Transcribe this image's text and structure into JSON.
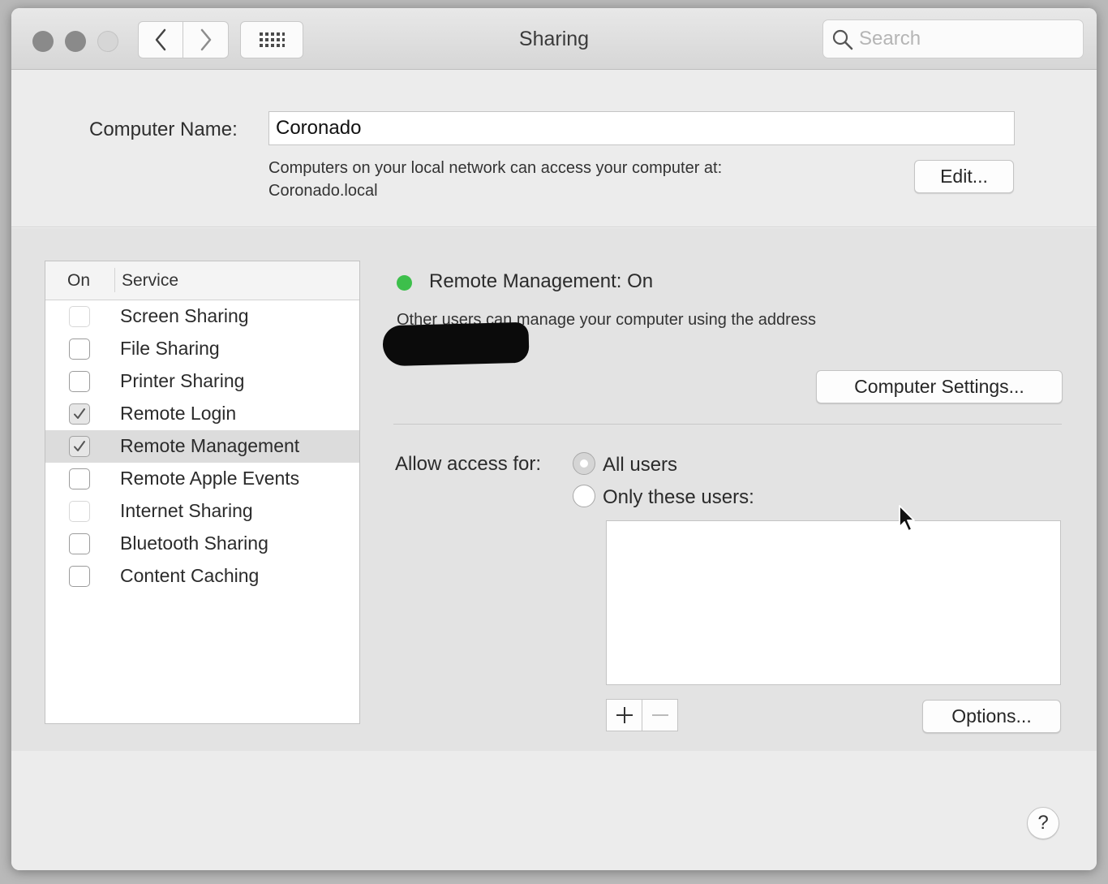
{
  "window": {
    "title": "Sharing"
  },
  "toolbar": {
    "search_placeholder": "Search",
    "icons": [
      "back-icon",
      "forward-icon",
      "show-all-grid-icon",
      "search-icon"
    ]
  },
  "computer_name": {
    "label": "Computer Name:",
    "value": "Coronado",
    "note_line1": "Computers on your local network can access your computer at:",
    "note_line2": "Coronado.local",
    "edit_label": "Edit..."
  },
  "services": {
    "col_on": "On",
    "col_service": "Service",
    "items": [
      {
        "label": "Screen Sharing",
        "checked": false,
        "enabled": false
      },
      {
        "label": "File Sharing",
        "checked": false,
        "enabled": true
      },
      {
        "label": "Printer Sharing",
        "checked": false,
        "enabled": true
      },
      {
        "label": "Remote Login",
        "checked": true,
        "enabled": true
      },
      {
        "label": "Remote Management",
        "checked": true,
        "enabled": true,
        "selected": true
      },
      {
        "label": "Remote Apple Events",
        "checked": false,
        "enabled": true
      },
      {
        "label": "Internet Sharing",
        "checked": false,
        "enabled": false
      },
      {
        "label": "Bluetooth Sharing",
        "checked": false,
        "enabled": true
      },
      {
        "label": "Content Caching",
        "checked": false,
        "enabled": true
      }
    ]
  },
  "detail": {
    "status_text": "Remote Management: On",
    "status_color": "#3dbf4b",
    "address_note": "Other users can manage your computer using the address",
    "computer_settings_label": "Computer Settings...",
    "allow_label": "Allow access for:",
    "radio_all": "All users",
    "radio_only": "Only these users:",
    "selected_access": "All users",
    "plus_symbol": "+",
    "minus_symbol": "−",
    "options_label": "Options..."
  },
  "footer": {
    "help_label": "?"
  }
}
